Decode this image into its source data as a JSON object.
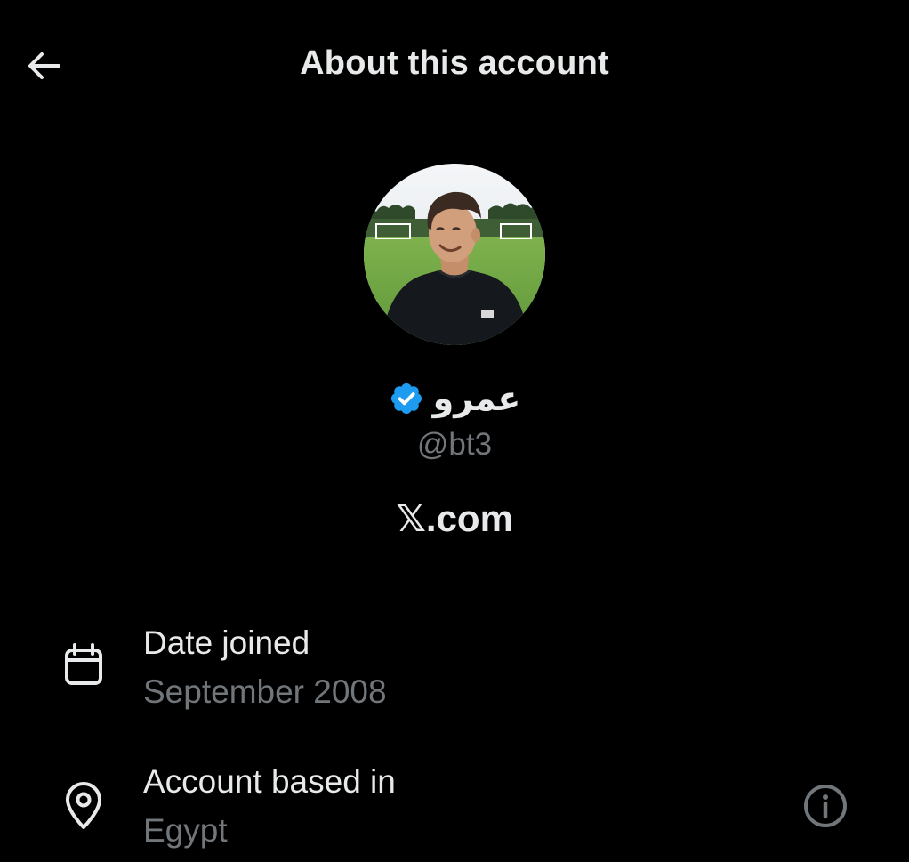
{
  "header": {
    "back_icon": "arrow-left-icon",
    "title": "About this account"
  },
  "profile": {
    "avatar_icon": "profile-photo",
    "display_name": "عمرو",
    "verified_icon": "verified-badge-icon",
    "verified_color": "#1d9bf0",
    "handle": "@bt3",
    "brand_link": "𝕏.com"
  },
  "details": [
    {
      "icon": "calendar-icon",
      "label": "Date joined",
      "value": "September 2008"
    },
    {
      "icon": "location-pin-icon",
      "label": "Account based in",
      "value": "Egypt",
      "action_icon": "info-icon"
    }
  ],
  "colors": {
    "background": "#000000",
    "primary_text": "#e7e9ea",
    "secondary_text": "#71767b",
    "accent": "#1d9bf0"
  }
}
